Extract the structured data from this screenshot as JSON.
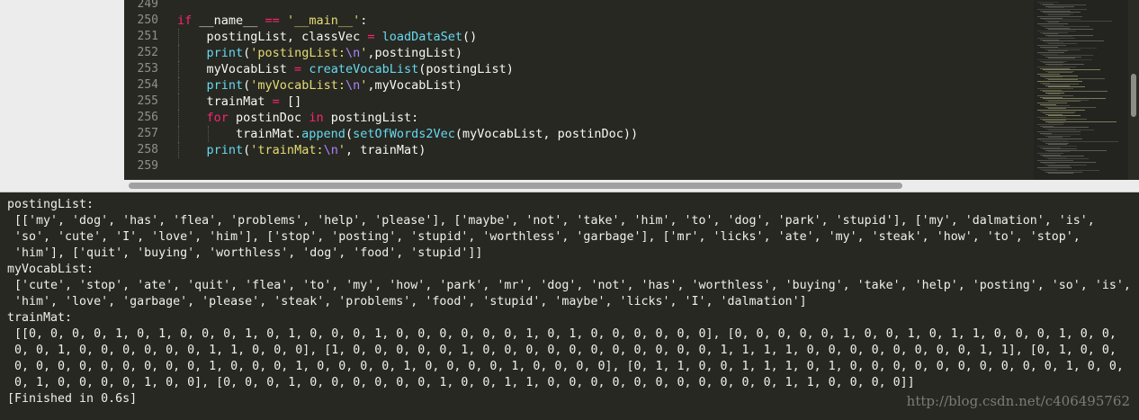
{
  "editor": {
    "line_numbers": [
      "249",
      "250",
      "251",
      "252",
      "253",
      "254",
      "255",
      "256",
      "257",
      "258",
      "259"
    ],
    "lines": [
      [],
      [
        [
          "kw",
          "if"
        ],
        [
          "t",
          " __name__ "
        ],
        [
          "kw",
          "=="
        ],
        [
          "t",
          " "
        ],
        [
          "st",
          "'__main__'"
        ],
        [
          "t",
          ":"
        ]
      ],
      [
        [
          "t",
          "    postingList, classVec "
        ],
        [
          "kw",
          "="
        ],
        [
          "t",
          " "
        ],
        [
          "fn",
          "loadDataSet"
        ],
        [
          "t",
          "()"
        ]
      ],
      [
        [
          "t",
          "    "
        ],
        [
          "fn",
          "print"
        ],
        [
          "t",
          "("
        ],
        [
          "st",
          "'postingList:"
        ],
        [
          "esc",
          "\\n"
        ],
        [
          "st",
          "'"
        ],
        [
          "t",
          ",postingList)"
        ]
      ],
      [
        [
          "t",
          "    myVocabList "
        ],
        [
          "kw",
          "="
        ],
        [
          "t",
          " "
        ],
        [
          "fn",
          "createVocabList"
        ],
        [
          "t",
          "(postingList)"
        ]
      ],
      [
        [
          "t",
          "    "
        ],
        [
          "fn",
          "print"
        ],
        [
          "t",
          "("
        ],
        [
          "st",
          "'myVocabList:"
        ],
        [
          "esc",
          "\\n"
        ],
        [
          "st",
          "'"
        ],
        [
          "t",
          ",myVocabList)"
        ]
      ],
      [
        [
          "t",
          "    trainMat "
        ],
        [
          "kw",
          "="
        ],
        [
          "t",
          " []"
        ]
      ],
      [
        [
          "t",
          "    "
        ],
        [
          "kw",
          "for"
        ],
        [
          "t",
          " postinDoc "
        ],
        [
          "kw",
          "in"
        ],
        [
          "t",
          " postingList:"
        ]
      ],
      [
        [
          "t",
          "        trainMat."
        ],
        [
          "fn",
          "append"
        ],
        [
          "t",
          "("
        ],
        [
          "fn",
          "setOfWords2Vec"
        ],
        [
          "t",
          "(myVocabList, postinDoc))"
        ]
      ],
      [
        [
          "t",
          "    "
        ],
        [
          "fn",
          "print"
        ],
        [
          "t",
          "("
        ],
        [
          "st",
          "'trainMat:"
        ],
        [
          "esc",
          "\\n"
        ],
        [
          "st",
          "'"
        ],
        [
          "t",
          ", trainMat)"
        ]
      ],
      []
    ]
  },
  "output": {
    "lines": [
      "postingList:",
      " [['my', 'dog', 'has', 'flea', 'problems', 'help', 'please'], ['maybe', 'not', 'take', 'him', 'to', 'dog', 'park', 'stupid'], ['my', 'dalmation', 'is',",
      " 'so', 'cute', 'I', 'love', 'him'], ['stop', 'posting', 'stupid', 'worthless', 'garbage'], ['mr', 'licks', 'ate', 'my', 'steak', 'how', 'to', 'stop',",
      " 'him'], ['quit', 'buying', 'worthless', 'dog', 'food', 'stupid']]",
      "myVocabList:",
      " ['cute', 'stop', 'ate', 'quit', 'flea', 'to', 'my', 'how', 'park', 'mr', 'dog', 'not', 'has', 'worthless', 'buying', 'take', 'help', 'posting', 'so', 'is',",
      " 'him', 'love', 'garbage', 'please', 'steak', 'problems', 'food', 'stupid', 'maybe', 'licks', 'I', 'dalmation']",
      "trainMat:",
      " [[0, 0, 0, 0, 1, 0, 1, 0, 0, 0, 1, 0, 1, 0, 0, 0, 1, 0, 0, 0, 0, 0, 0, 1, 0, 1, 0, 0, 0, 0, 0, 0], [0, 0, 0, 0, 0, 1, 0, 0, 1, 0, 1, 1, 0, 0, 0, 1, 0, 0,",
      " 0, 0, 1, 0, 0, 0, 0, 0, 0, 1, 1, 0, 0, 0], [1, 0, 0, 0, 0, 0, 1, 0, 0, 0, 0, 0, 0, 0, 0, 0, 0, 0, 1, 1, 1, 1, 0, 0, 0, 0, 0, 0, 0, 0, 1, 1], [0, 1, 0, 0,",
      " 0, 0, 0, 0, 0, 0, 0, 0, 0, 1, 0, 0, 0, 1, 0, 0, 0, 0, 1, 0, 0, 0, 0, 1, 0, 0, 0, 0], [0, 1, 1, 0, 0, 1, 1, 1, 0, 1, 0, 0, 0, 0, 0, 0, 0, 0, 0, 0, 1, 0, 0,",
      " 0, 1, 0, 0, 0, 0, 1, 0, 0], [0, 0, 0, 1, 0, 0, 0, 0, 0, 0, 1, 0, 0, 1, 1, 0, 0, 0, 0, 0, 0, 0, 0, 0, 0, 0, 1, 1, 0, 0, 0, 0]]",
      "[Finished in 0.6s]"
    ]
  },
  "watermark": "http://blog.csdn.net/c406495762"
}
